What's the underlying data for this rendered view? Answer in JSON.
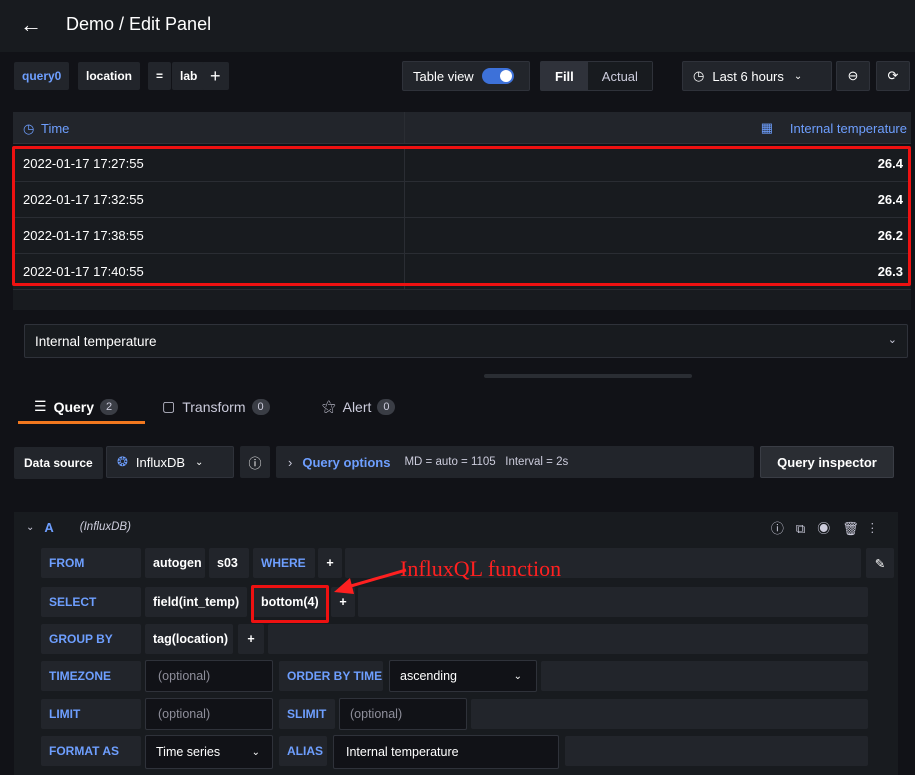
{
  "header": {
    "title": "Demo / Edit Panel"
  },
  "toolbar": {
    "query_name": "query0",
    "tag_key": "location",
    "operator": "=",
    "tag_value": "lab",
    "add": "+",
    "table_view_label": "Table view",
    "fill_label": "Fill",
    "actual_label": "Actual",
    "time_range": "Last 6 hours"
  },
  "table": {
    "col_time": "Time",
    "col_value": "Internal temperature",
    "rows": [
      {
        "time": "2022-01-17 17:27:55",
        "value": "26.4"
      },
      {
        "time": "2022-01-17 17:32:55",
        "value": "26.4"
      },
      {
        "time": "2022-01-17 17:38:55",
        "value": "26.2"
      },
      {
        "time": "2022-01-17 17:40:55",
        "value": "26.3"
      }
    ]
  },
  "series_select": "Internal temperature",
  "tabs": {
    "query": {
      "label": "Query",
      "count": "2"
    },
    "transform": {
      "label": "Transform",
      "count": "0"
    },
    "alert": {
      "label": "Alert",
      "count": "0"
    }
  },
  "datasource": {
    "label": "Data source",
    "name": "InfluxDB",
    "query_options": "Query options",
    "meta": "MD = auto = 1105   Interval = 2s",
    "inspector": "Query inspector"
  },
  "query": {
    "ref": "A",
    "ds": "(InfluxDB)",
    "from_kw": "FROM",
    "from_policy": "autogen",
    "from_measurement": "s03",
    "where_kw": "WHERE",
    "select_kw": "SELECT",
    "select_field": "field(int_temp)",
    "select_fn": "bottom(4)",
    "groupby_kw": "GROUP BY",
    "groupby_tag": "tag(location)",
    "timezone_kw": "TIMEZONE",
    "timezone_ph": "(optional)",
    "orderby_kw": "ORDER BY TIME",
    "orderby_val": "ascending",
    "limit_kw": "LIMIT",
    "limit_ph": "(optional)",
    "slimit_kw": "SLIMIT",
    "slimit_ph": "(optional)",
    "format_kw": "FORMAT AS",
    "format_val": "Time series",
    "alias_kw": "ALIAS",
    "alias_val": "Internal temperature",
    "plus": "+"
  },
  "annotation": "InfluxQL function",
  "colors": {
    "accent": "#6e9fff",
    "highlight": "#ee1111",
    "toggle": "#3d71d9"
  }
}
